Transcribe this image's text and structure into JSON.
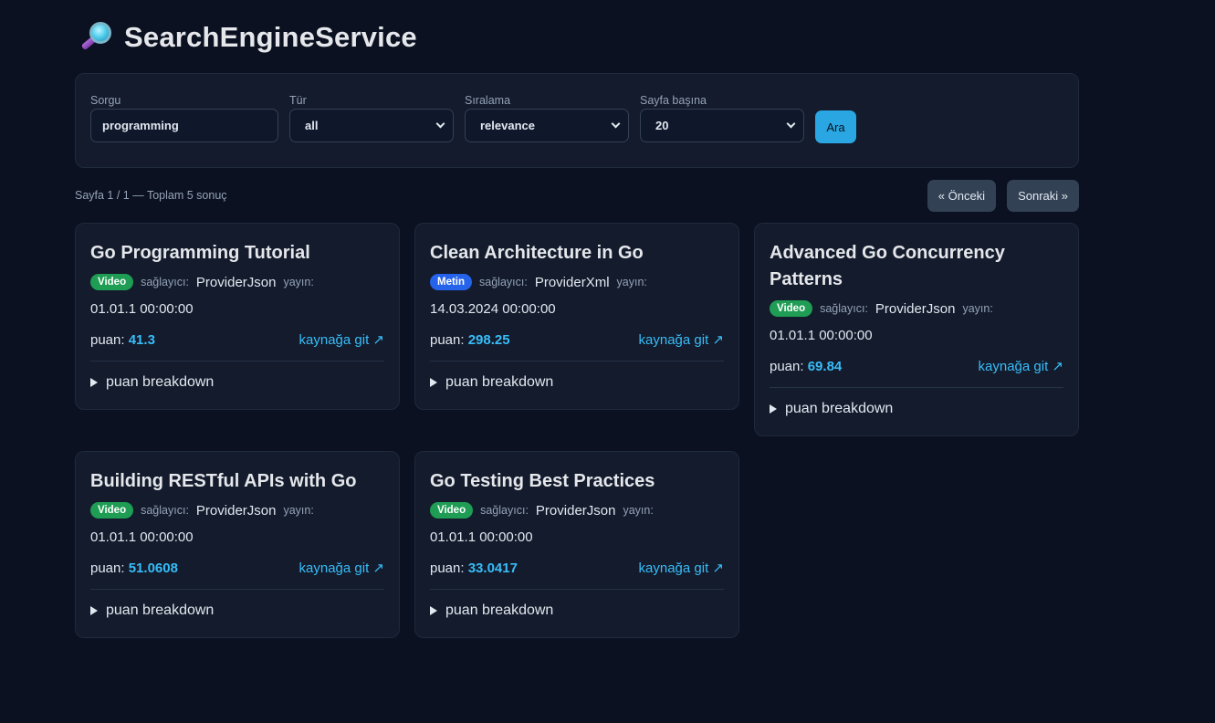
{
  "app": {
    "title": "SearchEngineService",
    "logo_icon": "magnifier-icon"
  },
  "search": {
    "query_label": "Sorgu",
    "query_value": "programming",
    "type_label": "Tür",
    "type_value": "all",
    "sort_label": "Sıralama",
    "sort_value": "relevance",
    "per_page_label": "Sayfa başına",
    "per_page_value": "20",
    "search_button": "Ara"
  },
  "results_info": {
    "text": "Sayfa 1 / 1 — Toplam 5 sonuç",
    "prev_button": "« Önceki",
    "next_button": "Sonraki »"
  },
  "labels": {
    "provider": "sağlayıcı:",
    "published": "yayın:",
    "score": "puan:",
    "source_link": "kaynağa git ↗",
    "breakdown": "puan breakdown"
  },
  "results": [
    {
      "title": "Go Programming Tutorial",
      "badge": "Video",
      "badge_type": "video",
      "provider": "ProviderJson",
      "date": "01.01.1 00:00:00",
      "score": "41.3"
    },
    {
      "title": "Clean Architecture in Go",
      "badge": "Metin",
      "badge_type": "metin",
      "provider": "ProviderXml",
      "date": "14.03.2024 00:00:00",
      "score": "298.25"
    },
    {
      "title": "Advanced Go Concurrency Patterns",
      "badge": "Video",
      "badge_type": "video",
      "provider": "ProviderJson",
      "date": "01.01.1 00:00:00",
      "score": "69.84"
    },
    {
      "title": "Building RESTful APIs with Go",
      "badge": "Video",
      "badge_type": "video",
      "provider": "ProviderJson",
      "date": "01.01.1 00:00:00",
      "score": "51.0608"
    },
    {
      "title": "Go Testing Best Practices",
      "badge": "Video",
      "badge_type": "video",
      "provider": "ProviderJson",
      "date": "01.01.1 00:00:00",
      "score": "33.0417"
    }
  ],
  "colors": {
    "background": "#0b1120",
    "panel": "#131b2c",
    "accent": "#38bdf8",
    "video_badge": "#1f9d55",
    "metin_badge": "#2563eb",
    "search_button": "#2aa7e2"
  }
}
